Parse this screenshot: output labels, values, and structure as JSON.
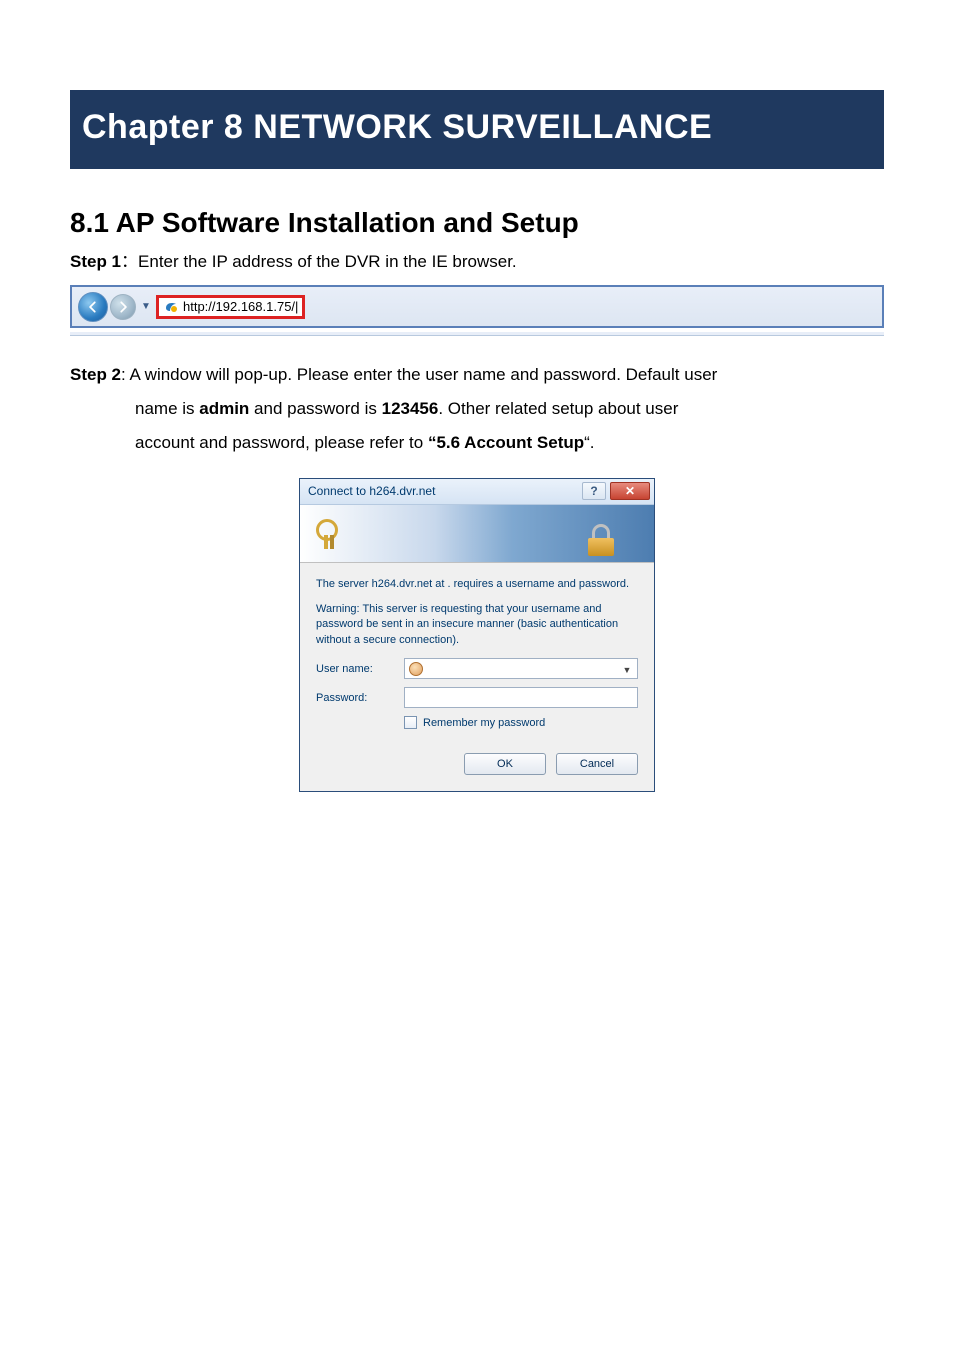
{
  "chapterTitle": "Chapter 8 NETWORK SURVEILLANCE",
  "sectionTitle": "8.1 AP Software Installation and Setup",
  "step1": {
    "label": "Step 1",
    "sep": "：",
    "text": "Enter the IP address of the DVR in the IE browser."
  },
  "ieBar": {
    "url": "http://192.168.1.75/|"
  },
  "step2": {
    "label": "Step 2",
    "line1a": ": A window will pop-up. Please enter the user name and password. Default user",
    "line2a": "name is ",
    "admin": "admin",
    "line2b": " and password is ",
    "pwd": "123456",
    "line2c": ". Other related setup about user",
    "line3a": "account and password, please refer to ",
    "ref": "“5.6 Account Setup",
    "line3b": "“."
  },
  "dialog": {
    "title": "Connect to h264.dvr.net",
    "helpGlyph": "?",
    "closeGlyph": "✕",
    "msg1": "The server h264.dvr.net at . requires a username and password.",
    "msg2": "Warning: This server is requesting that your username and password be sent in an insecure manner (basic authentication without a secure connection).",
    "userLabel": "User name:",
    "passLabel": "Password:",
    "rememberLabel": "Remember my password",
    "okLabel": "OK",
    "cancelLabel": "Cancel"
  }
}
